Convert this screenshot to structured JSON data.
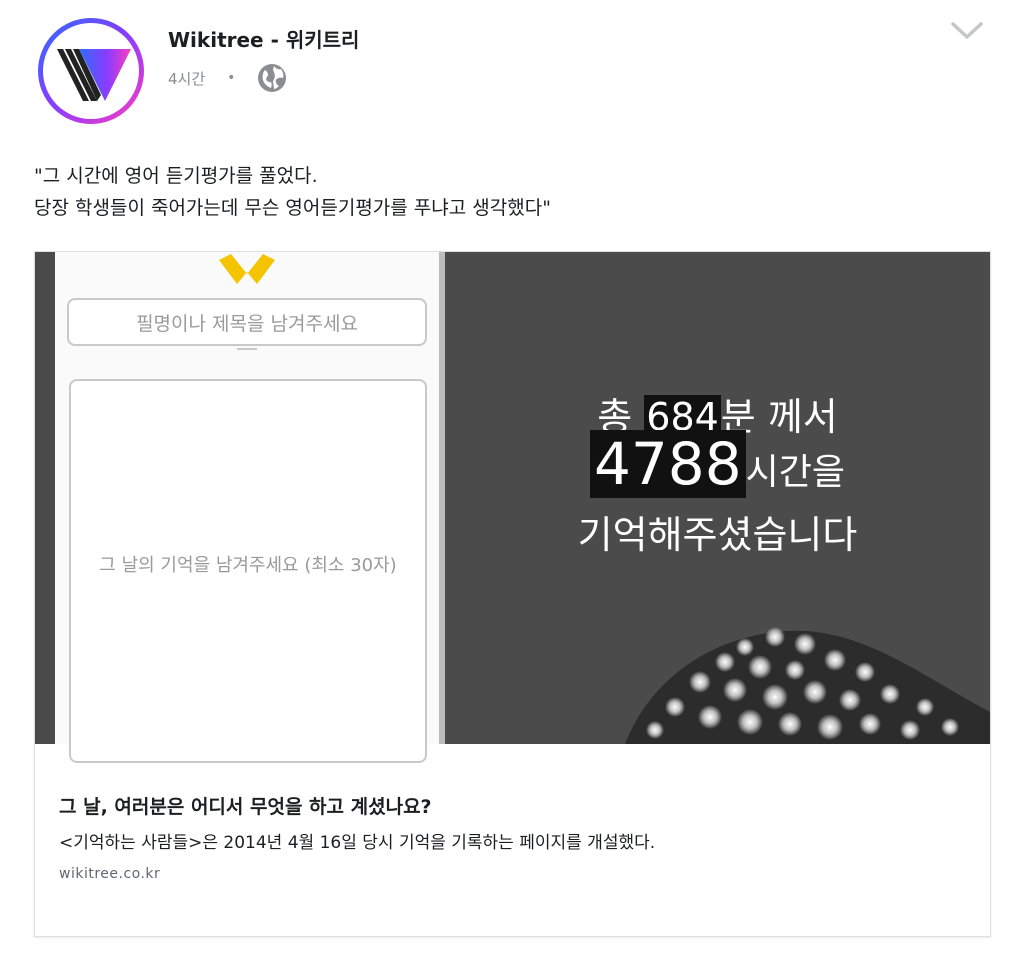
{
  "post": {
    "page_name": "Wikitree - 위키트리",
    "timestamp": "4시간",
    "separator": "•",
    "privacy_icon": "globe-icon",
    "menu_icon": "chevron-down-icon",
    "text_line1": "\"그 시간에 영어 듣기평가를 풀었다.",
    "text_line2": "당장 학생들이 죽어가는데 무슨 영어듣기평가를 푸냐고 생각했다\""
  },
  "link_card": {
    "image": {
      "name_placeholder": "필명이나 제목을 남겨주세요",
      "memory_placeholder": "그 날의 기억을 남겨주세요 (최소 30자)",
      "line1_prefix": "총 ",
      "line1_highlight": "684",
      "line1_suffix": "분 께서",
      "line2_highlight": "4788",
      "line2_suffix": "시간을",
      "line3": "기억해주셨습니다"
    },
    "title": "그 날, 여러분은 어디서 무엇을 하고 계셨나요?",
    "description": "<기억하는 사람들>은 2014년 4월 16일 당시 기억을 기록하는 페이지를 개설했다.",
    "domain": "wikitree.co.kr"
  },
  "colors": {
    "avatar_gradient": [
      "#2f6bff",
      "#8a3cff",
      "#ff3dbd"
    ],
    "ribbon": "#f5c400",
    "dark_panel": "#4b4b4b"
  }
}
